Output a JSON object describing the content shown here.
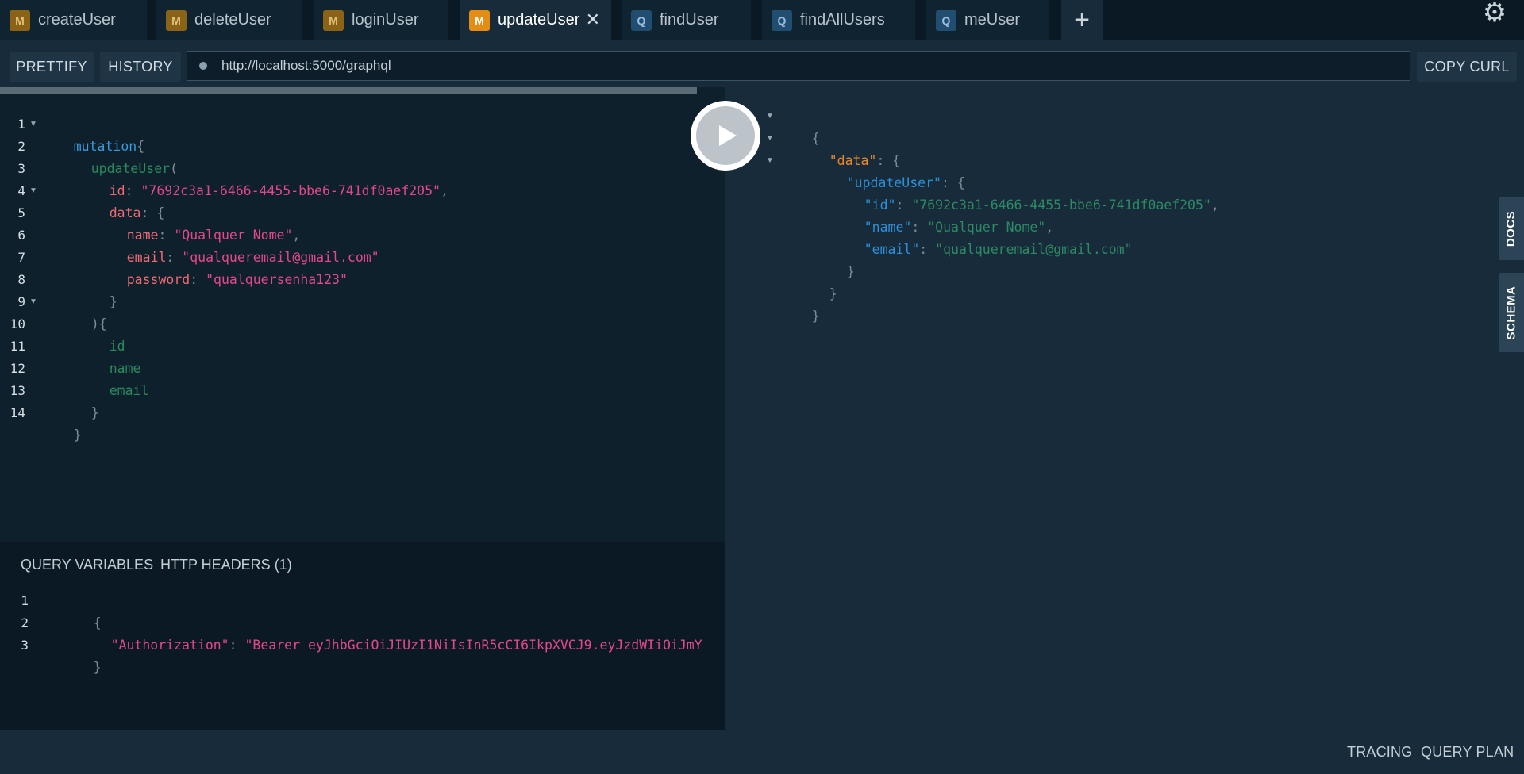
{
  "tabs": [
    {
      "type": "M",
      "label": "createUser"
    },
    {
      "type": "M",
      "label": "deleteUser"
    },
    {
      "type": "M",
      "label": "loginUser"
    },
    {
      "type": "M",
      "label": "updateUser",
      "close": "✕"
    },
    {
      "type": "Q",
      "label": "findUser"
    },
    {
      "type": "Q",
      "label": "findAllUsers"
    },
    {
      "type": "Q",
      "label": "meUser"
    }
  ],
  "add_tab_glyph": "+",
  "settings_glyph": "⚙",
  "toolbar": {
    "prettify": "PRETTIFY",
    "history": "HISTORY",
    "endpoint": "http://localhost:5000/graphql",
    "copy_curl": "COPY CURL"
  },
  "editor": {
    "line_numbers": [
      "1",
      "2",
      "3",
      "4",
      "5",
      "6",
      "7",
      "8",
      "9",
      "10",
      "11",
      "12",
      "13",
      "14"
    ],
    "l1_kw": "mutation",
    "l1_p": "{",
    "l2_fn": "updateUser",
    "l2_p": "(",
    "l3_arg": "id",
    "l3_colon": ": ",
    "l3_str": "\"7692c3a1-6466-4455-bbe6-741df0aef205\"",
    "l3_comma": ",",
    "l4_arg": "data",
    "l4_colon": ": ",
    "l4_p": "{",
    "l5_arg": "name",
    "l5_colon": ": ",
    "l5_str": "\"Qualquer Nome\"",
    "l5_comma": ",",
    "l6_arg": "email",
    "l6_colon": ": ",
    "l6_str": "\"qualqueremail@gmail.com\"",
    "l7_arg": "password",
    "l7_colon": ": ",
    "l7_str": "\"qualquersenha123\"",
    "l8_p": "}",
    "l9_p": "){",
    "l10_f": "id",
    "l11_f": "name",
    "l12_f": "email",
    "l13_p": "}",
    "l14_p": "}"
  },
  "result": {
    "r1": "{",
    "r2_key": "\"data\"",
    "r2_colon": ": ",
    "r2_p": "{",
    "r3_key": "\"updateUser\"",
    "r3_colon": ": ",
    "r3_p": "{",
    "r4_key": "\"id\"",
    "r4_colon": ": ",
    "r4_str": "\"7692c3a1-6466-4455-bbe6-741df0aef205\"",
    "r4_comma": ",",
    "r5_key": "\"name\"",
    "r5_colon": ": ",
    "r5_str": "\"Qualquer Nome\"",
    "r5_comma": ",",
    "r6_key": "\"email\"",
    "r6_colon": ": ",
    "r6_str": "\"qualqueremail@gmail.com\"",
    "r7": "}",
    "r8": "}",
    "r9": "}"
  },
  "side_tabs": {
    "docs": "DOCS",
    "schema": "SCHEMA"
  },
  "variables_panel": {
    "tab_query_variables": "QUERY VARIABLES",
    "tab_http_headers": "HTTP HEADERS (1)",
    "line_numbers": [
      "1",
      "2",
      "3"
    ],
    "v1": "{",
    "v2_key": "\"Authorization\"",
    "v2_colon": ": ",
    "v2_str": "\"Bearer eyJhbGciOiJIUzI1NiIsInR5cCI6IkpXVCJ9.eyJzdWIiOiJmY",
    "v3": "}"
  },
  "footer": {
    "tracing": "TRACING",
    "query_plan": "QUERY PLAN"
  }
}
